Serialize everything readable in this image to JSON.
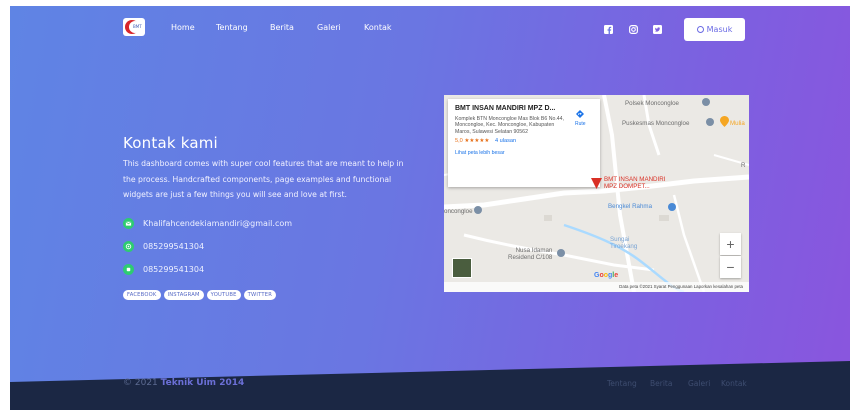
{
  "nav": {
    "logo_text": "BMT",
    "items": [
      "Home",
      "Tentang",
      "Berita",
      "Galeri",
      "Kontak"
    ],
    "social_icons": [
      "facebook-icon",
      "instagram-icon",
      "twitter-icon"
    ],
    "login_label": "Masuk"
  },
  "contact": {
    "title": "Kontak kami",
    "description": "This dashboard comes with super cool features that are meant to help in the process. Handcrafted components, page examples and functional widgets are just a few things you will see and love at first.",
    "email": "Khalifahcendekiamandiri@gmail.com",
    "phone": "085299541304",
    "whatsapp": "085299541304",
    "tags": [
      "FACEBOOK",
      "INSTAGRAM",
      "YOUTUBE",
      "TWITTER"
    ]
  },
  "map": {
    "place_name": "BMT INSAN MANDIRI MPZ D...",
    "address": "Komplek BTN Moncongloe Mas Blok B6 No.44, Moncongloe, Kec. Moncongloe, Kabupaten Maros, Sulawesi Selatan 90562",
    "rating": "5,0",
    "stars": "★★★★★",
    "reviews": "4 ulasan",
    "larger_map": "Lihat peta lebih besar",
    "directions": "Rute",
    "labels": {
      "polsek": "Polsek Moncongloe",
      "puskesmas": "Puskesmas Moncongloe",
      "mulia": "Mulia",
      "bmt_line1": "BMT INSAN MANDIRI",
      "bmt_line2": "MPZ DOMPET...",
      "bengkel": "Bengkel Rahma",
      "moncongloe": "oncongloe",
      "nusa_line1": "Nusa Idaman",
      "nusa_line2": "Residend C/108",
      "sungai_line1": "Sungai",
      "sungai_line2": "Tiroekang",
      "edge_r": "R"
    },
    "google_logo": "Google",
    "attribution": "Data peta ©2021   Syarat Penggunaan   Laporkan kesalahan peta",
    "zoom_in": "+",
    "zoom_out": "−"
  },
  "footer": {
    "copyright": "© 2021",
    "brand": "Teknik Uim 2014",
    "links": [
      "Tentang",
      "Berita",
      "Galeri",
      "Kontak"
    ]
  },
  "colors": {
    "gradient_start": "#5f84e4",
    "gradient_end": "#8a55de",
    "footer": "#1b2744",
    "contact_icon": "#2ecc71",
    "map_pin": "#d93025"
  }
}
